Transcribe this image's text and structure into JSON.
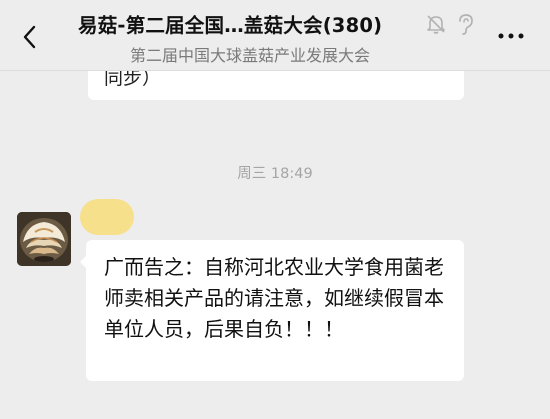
{
  "header": {
    "title": "易菇-第二届全国…盖菇大会(380)",
    "subtitle": "第二届中国大球盖菇产业发展大会",
    "back_icon": "chevron-left-icon",
    "mute_icon": "bell-muted-icon",
    "ear_icon": "ear-icon",
    "more_icon": "more-dots-icon"
  },
  "chat": {
    "previous_message_tail": "同步）",
    "timestamp": "周三 18:49",
    "message": {
      "text": "广而告之：自称河北农业大学食用菌老师卖相关产品的请注意，如继续假冒本单位人员，后果自负！！！"
    }
  },
  "colors": {
    "background": "#ededed",
    "bubble": "#ffffff",
    "name_highlight": "#f6e08b"
  }
}
